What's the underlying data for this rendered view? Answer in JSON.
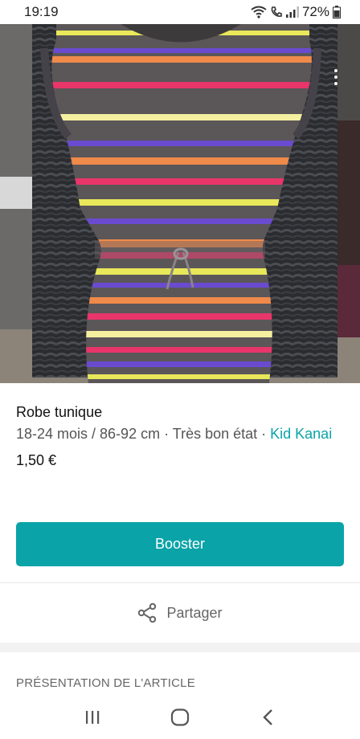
{
  "status_bar": {
    "time": "19:19",
    "battery": "72%",
    "icons": [
      "wifi-icon",
      "call-icon",
      "signal-icon",
      "battery-icon"
    ]
  },
  "photo": {
    "description_icons": [
      "more-options-icon"
    ]
  },
  "item": {
    "title": "Robe tunique",
    "size": "18-24 mois / 86-92 cm",
    "separator": " · ",
    "condition": "Très bon état",
    "brand": "Kid Kanai",
    "price": "1,50 €"
  },
  "actions": {
    "booster_label": "Booster",
    "share_label": "Partager"
  },
  "section": {
    "title": "PRÉSENTATION DE L'ARTICLE"
  },
  "colors": {
    "accent": "#09a3a8",
    "stripes": [
      "#e8e85a",
      "#f08a4a",
      "#e8356a",
      "#6a4bd0",
      "#f5f0a0"
    ]
  }
}
